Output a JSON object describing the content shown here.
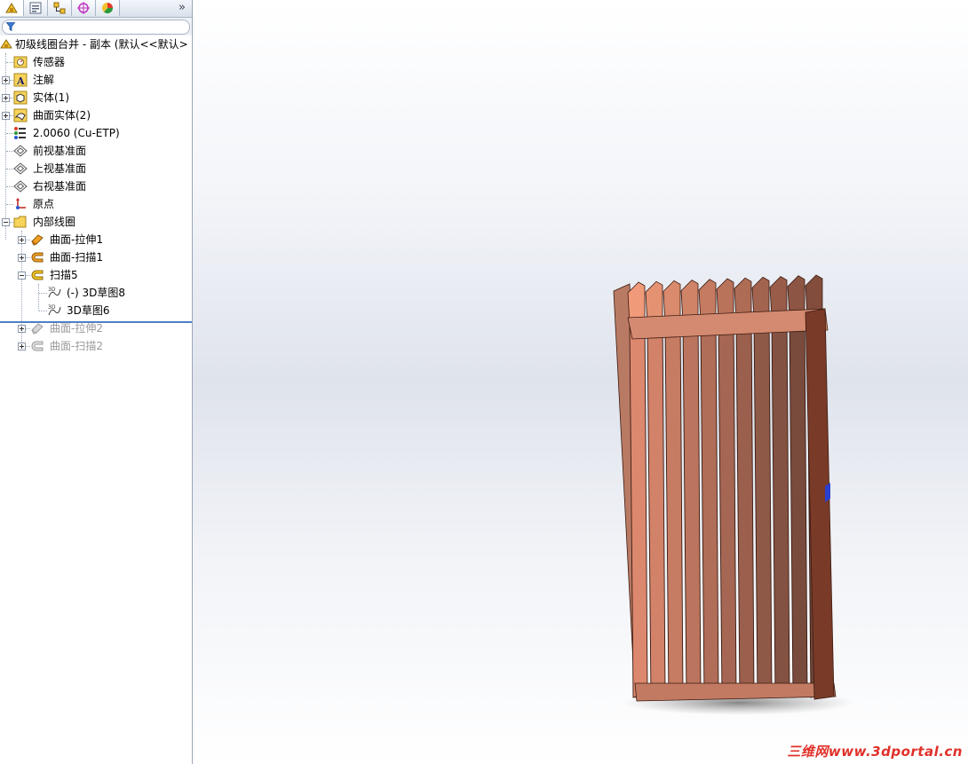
{
  "panel": {
    "tabs": [
      {
        "icon": "feature-manager-icon"
      },
      {
        "icon": "property-manager-icon"
      },
      {
        "icon": "configuration-manager-icon"
      },
      {
        "icon": "dimxpert-icon"
      },
      {
        "icon": "display-manager-icon"
      }
    ],
    "more": "»",
    "filter_icon": "filter-icon"
  },
  "tree": {
    "root": "初级线圈台并 - 副本  (默认<<默认>",
    "items": [
      {
        "label": "传感器",
        "icon": "sensors-folder-icon"
      },
      {
        "label": "注解",
        "icon": "annotations-icon"
      },
      {
        "label": "实体(1)",
        "icon": "solid-bodies-icon"
      },
      {
        "label": "曲面实体(2)",
        "icon": "surface-bodies-icon"
      },
      {
        "label": "2.0060 (Cu-ETP)",
        "icon": "material-icon"
      },
      {
        "label": "前视基准面",
        "icon": "plane-icon"
      },
      {
        "label": "上视基准面",
        "icon": "plane-icon"
      },
      {
        "label": "右视基准面",
        "icon": "plane-icon"
      },
      {
        "label": "原点",
        "icon": "origin-icon"
      },
      {
        "label": "内部线圈",
        "icon": "folder-icon"
      },
      {
        "label": "曲面-拉伸1",
        "icon": "surface-extrude-icon"
      },
      {
        "label": "曲面-扫描1",
        "icon": "surface-sweep-icon"
      },
      {
        "label": "扫描5",
        "icon": "sweep-icon"
      },
      {
        "label": "(-) 3D草图8",
        "icon": "sketch3d-icon"
      },
      {
        "label": "3D草图6",
        "icon": "sketch3d-icon"
      },
      {
        "label": "曲面-拉伸2",
        "icon": "surface-extrude-icon"
      },
      {
        "label": "曲面-扫描2",
        "icon": "surface-sweep-icon"
      }
    ]
  },
  "viewport": {
    "watermark": "三维网www.3dportal.cn",
    "model_color": "#c77a5e"
  }
}
